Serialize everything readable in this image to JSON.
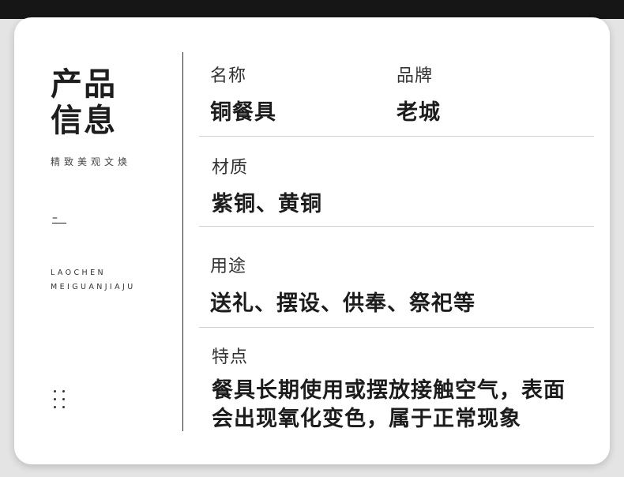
{
  "sidebar": {
    "title": "产品\n信息",
    "subtitle": "精致美观文焕",
    "dash": "–",
    "brand_en_line1": "LAOCHEN",
    "brand_en_line2": "MEIGUANJIAJU"
  },
  "specs": {
    "name_label": "名称",
    "name_value": "铜餐具",
    "brand_label": "品牌",
    "brand_value": "老城",
    "material_label": "材质",
    "material_value": "紫铜、黄铜",
    "usage_label": "用途",
    "usage_value": "送礼、摆设、供奉、祭祀等",
    "feature_label": "特点",
    "feature_value_line1": "餐具长期使用或摆放接触空气，表面",
    "feature_value_line2": "会出现氧化变色，属于正常现象"
  },
  "colors": {
    "topbar": "#161616",
    "card": "#ffffff",
    "background": "#e4e4e4",
    "text": "#2a2a2a"
  }
}
